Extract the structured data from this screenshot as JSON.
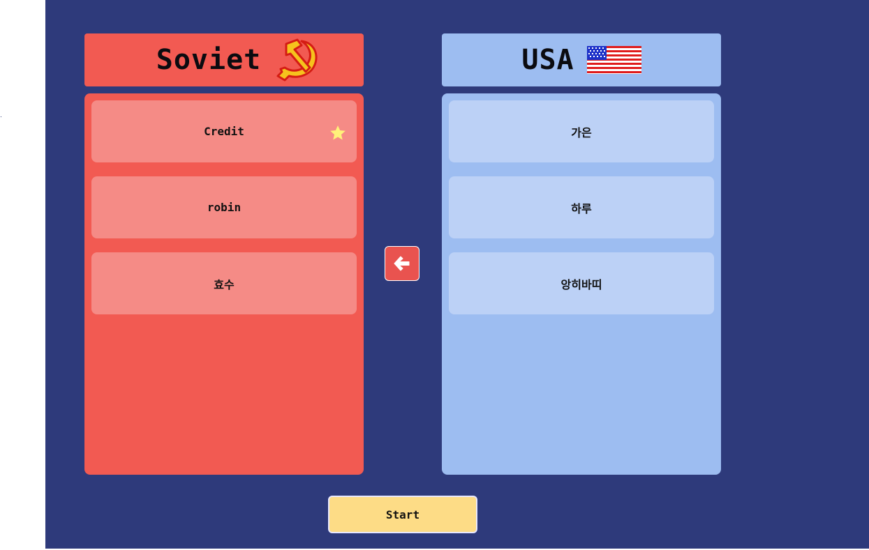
{
  "teams": {
    "soviet": {
      "name": "Soviet",
      "flag_icon": "hammer-sickle-icon",
      "color": "#f25a52",
      "members": [
        "Credit",
        "robin",
        "효수"
      ],
      "starred_member": "Credit"
    },
    "usa": {
      "name": "USA",
      "flag_icon": "us-flag-icon",
      "color": "#9dbdf1",
      "members": [
        "가은",
        "하루",
        "앙히바띠"
      ]
    }
  },
  "controls": {
    "move_icon": "arrow-left-icon",
    "start_label": "Start"
  },
  "colors": {
    "background": "#2e3a7b",
    "start_button": "#fddc86",
    "star": "#fff27a"
  }
}
